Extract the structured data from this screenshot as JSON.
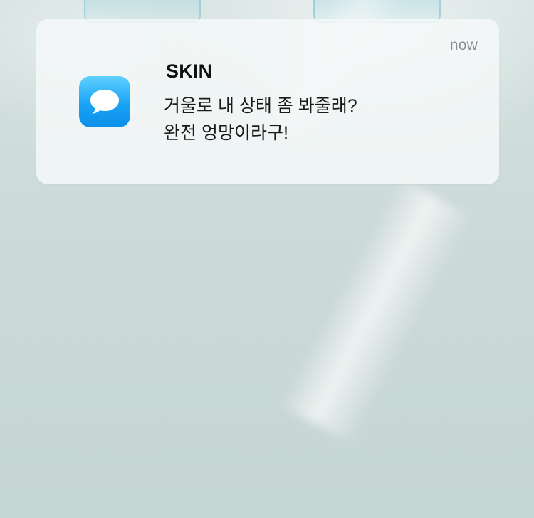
{
  "notification": {
    "app_icon": "messages-speech-bubble-icon",
    "title": "SKIN",
    "timestamp": "now",
    "message_lines": [
      "거울로 내 상태 좀 봐줄래?",
      "완전 엉망이라구!"
    ]
  },
  "colors": {
    "icon_gradient_top": "#5fd0ff",
    "icon_gradient_bottom": "#0a8fe8",
    "card_background": "#f4f8f8",
    "backdrop": "#c9d8d6"
  }
}
